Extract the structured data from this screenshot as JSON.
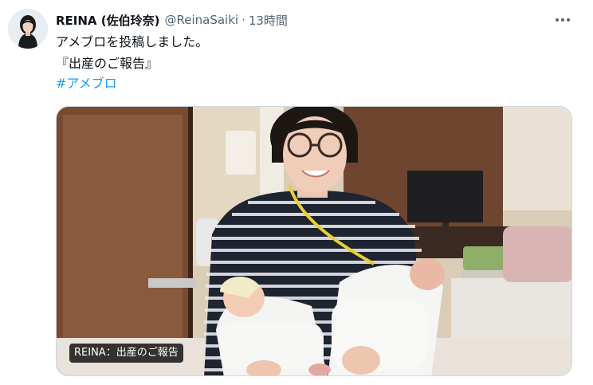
{
  "tweet": {
    "author_name": "REINA (佐伯玲奈)",
    "handle": "@ReinaSaiki",
    "separator": "·",
    "time": "13時間",
    "lines": [
      "アメブロを投稿しました。",
      "『出産のご報告』"
    ],
    "hashtag": "#アメブロ",
    "media": {
      "caption": "REINA：出産のご報告",
      "description_icon": "photo-of-mother-holding-twin-newborns"
    },
    "icons": [
      "avatar",
      "more-options-icon"
    ]
  },
  "colors": {
    "link": "#1d9bf0",
    "secondary_text": "#536471",
    "primary_text": "#0f1419",
    "border": "#cfd9de"
  }
}
